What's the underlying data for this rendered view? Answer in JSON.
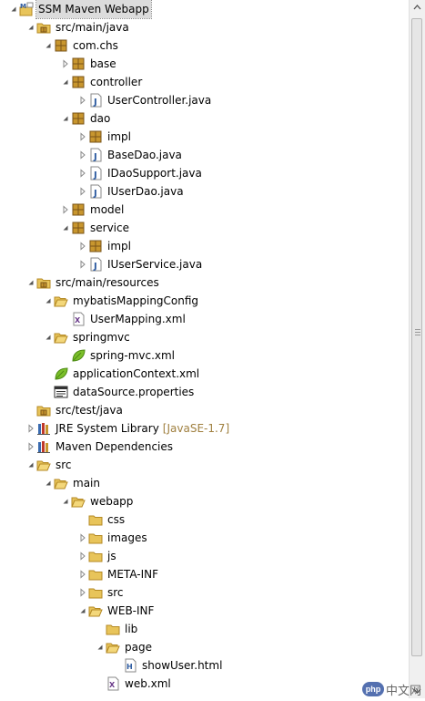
{
  "project": {
    "title": "SSM Maven Webapp",
    "items": [
      {
        "id": "project-root",
        "label": "SSM Maven Webapp",
        "depth": 0,
        "icon": "project",
        "toggle": "expanded",
        "selected": true
      },
      {
        "id": "src-main-java",
        "label": "src/main/java",
        "depth": 1,
        "icon": "srcfolder",
        "toggle": "expanded"
      },
      {
        "id": "pkg-com-chs",
        "label": "com.chs",
        "depth": 2,
        "icon": "package",
        "toggle": "expanded"
      },
      {
        "id": "pkg-base",
        "label": "base",
        "depth": 3,
        "icon": "package",
        "toggle": "collapsed"
      },
      {
        "id": "pkg-controller",
        "label": "controller",
        "depth": 3,
        "icon": "package",
        "toggle": "expanded"
      },
      {
        "id": "file-usercontroller",
        "label": "UserController.java",
        "depth": 4,
        "icon": "java",
        "toggle": "collapsed"
      },
      {
        "id": "pkg-dao",
        "label": "dao",
        "depth": 3,
        "icon": "package",
        "toggle": "expanded"
      },
      {
        "id": "pkg-dao-impl",
        "label": "impl",
        "depth": 4,
        "icon": "package",
        "toggle": "collapsed"
      },
      {
        "id": "file-basedao",
        "label": "BaseDao.java",
        "depth": 4,
        "icon": "java",
        "toggle": "collapsed"
      },
      {
        "id": "file-idaosupport",
        "label": "IDaoSupport.java",
        "depth": 4,
        "icon": "java",
        "toggle": "collapsed"
      },
      {
        "id": "file-iuserdao",
        "label": "IUserDao.java",
        "depth": 4,
        "icon": "java",
        "toggle": "collapsed"
      },
      {
        "id": "pkg-model",
        "label": "model",
        "depth": 3,
        "icon": "package",
        "toggle": "collapsed"
      },
      {
        "id": "pkg-service",
        "label": "service",
        "depth": 3,
        "icon": "package",
        "toggle": "expanded"
      },
      {
        "id": "pkg-service-impl",
        "label": "impl",
        "depth": 4,
        "icon": "package",
        "toggle": "collapsed"
      },
      {
        "id": "file-iuserservice",
        "label": "IUserService.java",
        "depth": 4,
        "icon": "java",
        "toggle": "collapsed"
      },
      {
        "id": "src-main-resources",
        "label": "src/main/resources",
        "depth": 1,
        "icon": "srcfolder",
        "toggle": "expanded"
      },
      {
        "id": "folder-mybatis",
        "label": "mybatisMappingConfig",
        "depth": 2,
        "icon": "folder-open",
        "toggle": "expanded"
      },
      {
        "id": "file-usermapping",
        "label": "UserMapping.xml",
        "depth": 3,
        "icon": "xml",
        "toggle": "none"
      },
      {
        "id": "folder-springmvc",
        "label": "springmvc",
        "depth": 2,
        "icon": "folder-open",
        "toggle": "expanded"
      },
      {
        "id": "file-spring-mvc",
        "label": "spring-mvc.xml",
        "depth": 3,
        "icon": "leaf",
        "toggle": "none"
      },
      {
        "id": "file-appcontext",
        "label": "applicationContext.xml",
        "depth": 2,
        "icon": "leaf",
        "toggle": "none"
      },
      {
        "id": "file-datasource",
        "label": "dataSource.properties",
        "depth": 2,
        "icon": "properties",
        "toggle": "none"
      },
      {
        "id": "src-test-java",
        "label": "src/test/java",
        "depth": 1,
        "icon": "srcfolder",
        "toggle": "none"
      },
      {
        "id": "lib-jre",
        "label": "JRE System Library",
        "decoration": "[JavaSE-1.7]",
        "depth": 1,
        "icon": "library",
        "toggle": "collapsed"
      },
      {
        "id": "lib-maven",
        "label": "Maven Dependencies",
        "depth": 1,
        "icon": "library",
        "toggle": "collapsed"
      },
      {
        "id": "folder-src",
        "label": "src",
        "depth": 1,
        "icon": "folder-open",
        "toggle": "expanded"
      },
      {
        "id": "folder-main",
        "label": "main",
        "depth": 2,
        "icon": "folder-open",
        "toggle": "expanded"
      },
      {
        "id": "folder-webapp",
        "label": "webapp",
        "depth": 3,
        "icon": "folder-open",
        "toggle": "expanded"
      },
      {
        "id": "folder-css",
        "label": "css",
        "depth": 4,
        "icon": "folder",
        "toggle": "none"
      },
      {
        "id": "folder-images",
        "label": "images",
        "depth": 4,
        "icon": "folder",
        "toggle": "collapsed"
      },
      {
        "id": "folder-js",
        "label": "js",
        "depth": 4,
        "icon": "folder",
        "toggle": "collapsed"
      },
      {
        "id": "folder-meta-inf",
        "label": "META-INF",
        "depth": 4,
        "icon": "folder",
        "toggle": "collapsed"
      },
      {
        "id": "folder-webapp-src",
        "label": "src",
        "depth": 4,
        "icon": "folder",
        "toggle": "collapsed"
      },
      {
        "id": "folder-web-inf",
        "label": "WEB-INF",
        "depth": 4,
        "icon": "folder-open",
        "toggle": "expanded"
      },
      {
        "id": "folder-lib",
        "label": "lib",
        "depth": 5,
        "icon": "folder",
        "toggle": "none"
      },
      {
        "id": "folder-page",
        "label": "page",
        "depth": 5,
        "icon": "folder-open",
        "toggle": "expanded"
      },
      {
        "id": "file-showuser",
        "label": "showUser.html",
        "depth": 6,
        "icon": "html",
        "toggle": "none"
      },
      {
        "id": "file-webxml",
        "label": "web.xml",
        "depth": 5,
        "icon": "xml",
        "toggle": "none"
      }
    ]
  },
  "watermark": {
    "logo_text": "php",
    "text": "中文网"
  },
  "colors": {
    "package": "#c8962e",
    "package_dark": "#7a5418",
    "folder": "#e8c45a",
    "folder_edge": "#b58a24",
    "java_blue": "#2c5aa0",
    "leaf_green": "#7bbf2a",
    "library": "#3a6bb0",
    "selection": "#dcdcdc"
  }
}
